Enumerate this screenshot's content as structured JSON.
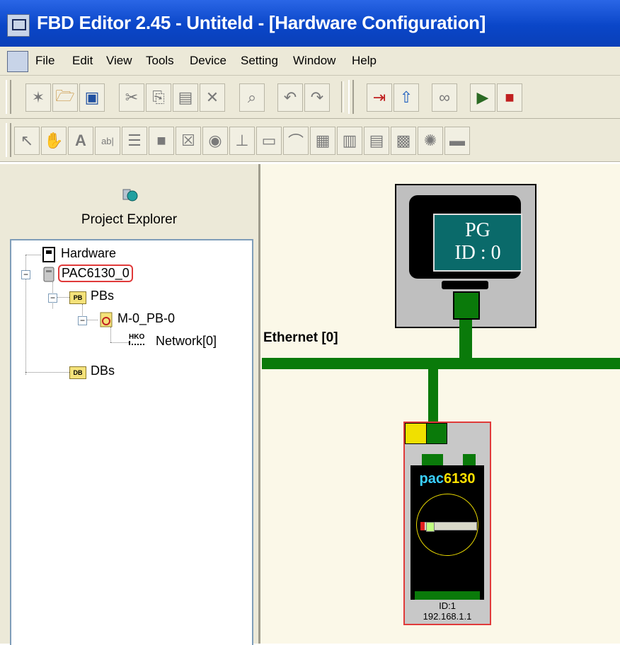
{
  "window": {
    "title": "FBD Editor 2.45 - Untiteld - [Hardware Configuration]"
  },
  "menu": [
    "File",
    "Edit",
    "View",
    "Tools",
    "Device",
    "Setting",
    "Window",
    "Help"
  ],
  "toolbar1": {
    "icons": [
      "new-icon",
      "open-icon",
      "save-icon",
      "cut-icon",
      "copy-icon",
      "paste-icon",
      "delete-icon",
      "find-icon",
      "undo-icon",
      "redo-icon",
      "download-icon",
      "upload-icon",
      "monitor-icon",
      "run-icon",
      "stop-icon"
    ]
  },
  "toolbar2": {
    "icons": [
      "select-icon",
      "hand-icon",
      "text-icon",
      "label-icon",
      "listbox-icon",
      "rect-icon",
      "checkbox-icon",
      "radio-icon",
      "slider-icon",
      "edit-icon",
      "curve-icon",
      "group-icon",
      "table-icon",
      "grid-icon",
      "image-icon",
      "gear-icon",
      "panel-icon"
    ]
  },
  "project_explorer": {
    "title": "Project Explorer",
    "tree": {
      "hardware": "Hardware",
      "device": "PAC6130_0",
      "pbs": "PBs",
      "pb_folder_badge": "PB",
      "pb_item": "M-0_PB-0",
      "network": "Network[0]",
      "network_badge": "HKO",
      "dbs": "DBs",
      "db_folder_badge": "DB"
    }
  },
  "canvas": {
    "pg_label_line1": "PG",
    "pg_label_line2": "ID : 0",
    "ethernet_label": "Ethernet [0]",
    "pac": {
      "brand_a": "pac",
      "brand_b": "6130",
      "id": "ID:1",
      "ip": "192.168.1.1"
    }
  },
  "colors": {
    "bus": "#0a7a0a",
    "titlebar": "#0a46c8",
    "selection": "#e03a3a"
  }
}
